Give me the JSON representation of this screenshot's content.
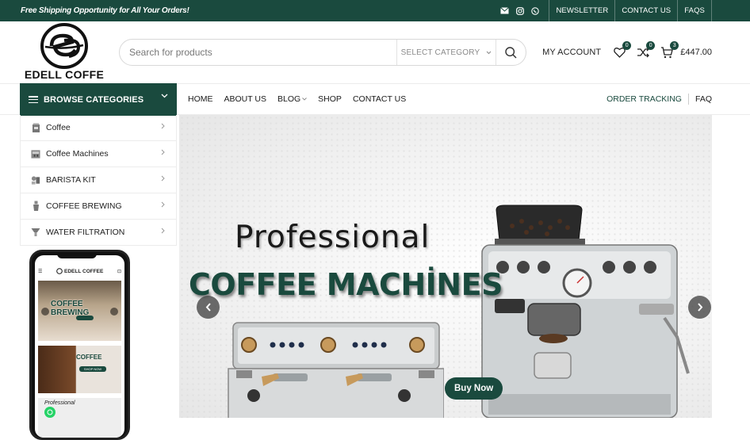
{
  "topbar": {
    "promo": "Free Shipping Opportunity for All Your Orders!",
    "social_icons": [
      "mail-icon",
      "instagram-icon",
      "whatsapp-icon"
    ],
    "links": [
      "NEWSLETTER",
      "CONTACT US",
      "FAQS"
    ]
  },
  "brand": {
    "name": "EDELL COFFE"
  },
  "search": {
    "placeholder": "Search for products",
    "category": "SELECT CATEGORY"
  },
  "account": {
    "label": "MY ACCOUNT",
    "wishlist_count": "0",
    "compare_count": "0",
    "cart_count": "3",
    "cart_total": "£447.00"
  },
  "nav": {
    "browse_label": "BROWSE CATEGORIES",
    "items": [
      "HOME",
      "ABOUT US",
      "BLOG",
      "SHOP",
      "CONTACT US"
    ],
    "right": [
      "ORDER TRACKING",
      "FAQ"
    ]
  },
  "categories": [
    "Coffee",
    "Coffee Machines",
    "BARISTA KIT",
    "COFFEE BREWING",
    "WATER FILTRATION"
  ],
  "phone": {
    "brand": "EDELL COFFEE",
    "banner1": "COFFEE BREWING",
    "banner2": "COFFEE",
    "banner2_button": "SHOP NOW",
    "banner3": "Professional"
  },
  "hero": {
    "line1": "Professional",
    "line2": "COFFEE MACHİNES",
    "button": "Buy Now"
  },
  "colors": {
    "brand_green": "#1a4a3e",
    "top_bar": "#1a4a3e"
  }
}
